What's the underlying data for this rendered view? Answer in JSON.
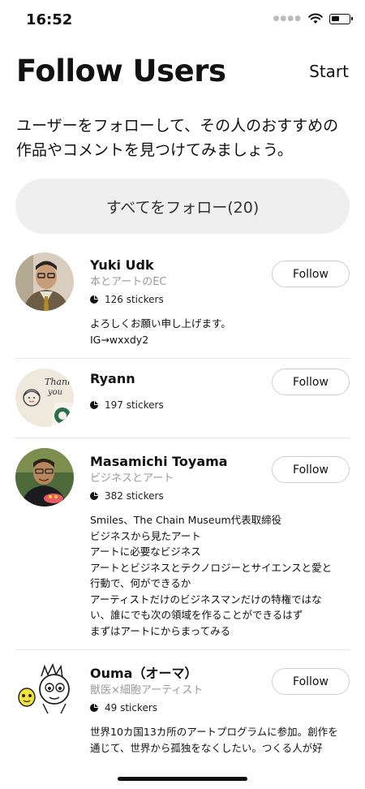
{
  "status_bar": {
    "time": "16:52"
  },
  "header": {
    "title": "Follow Users",
    "start_label": "Start"
  },
  "intro": {
    "line1": "ユーザーをフォローして、その人のおすすめの",
    "line2": "作品やコメントを見つけてみましょう。"
  },
  "follow_all_label": "すべてをフォロー(20)",
  "users": [
    {
      "name": "Yuki  Udk",
      "subtitle": "本とアートのEC",
      "stickers": "126 stickers",
      "follow_label": "Follow",
      "bio": [
        "よろしくお願い申し上げます。",
        "IG→wxxdy2"
      ]
    },
    {
      "name": "Ryann",
      "subtitle": "",
      "stickers": "197 stickers",
      "follow_label": "Follow",
      "bio": []
    },
    {
      "name": "Masamichi Toyama",
      "subtitle": "ビジネスとアート",
      "stickers": "382 stickers",
      "follow_label": "Follow",
      "bio": [
        "Smiles、The Chain Museum代表取締役",
        "ビジネスから見たアート",
        "アートに必要なビジネス",
        "アートとビジネスとテクノロジーとサイエンスと愛と",
        "行動で、何ができるか",
        "アーティストだけのビジネスマンだけの特権ではな",
        "い、誰にでも次の領域を作ることができるはず",
        "まずはアートにからまってみる"
      ]
    },
    {
      "name": "Ouma（オーマ）",
      "subtitle": "獣医×細胞アーティスト",
      "stickers": "49 stickers",
      "follow_label": "Follow",
      "bio": [
        "世界10カ国13カ所のアートプログラムに参加。創作を",
        "通じて、世界から孤独をなくしたい。つくる人が好"
      ]
    }
  ]
}
